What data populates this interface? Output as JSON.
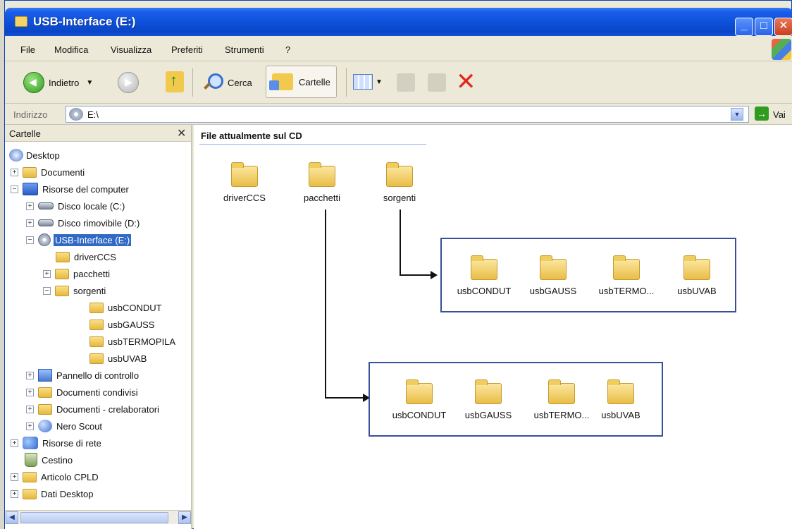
{
  "window": {
    "title": "USB-Interface (E:)"
  },
  "menu": [
    "File",
    "Modifica",
    "Visualizza",
    "Preferiti",
    "Strumenti",
    "?"
  ],
  "toolbar": {
    "back_label": "Indietro",
    "search_label": "Cerca",
    "folders_label": "Cartelle"
  },
  "address": {
    "label": "Indirizzo",
    "value": "E:\\",
    "go_label": "Vai"
  },
  "left_pane": {
    "title": "Cartelle",
    "tree": [
      {
        "label": "Desktop"
      },
      {
        "label": "Documenti"
      },
      {
        "label": "Risorse del computer"
      },
      {
        "label": "Disco locale (C:)"
      },
      {
        "label": "Disco rimovibile (D:)"
      },
      {
        "label": "USB-Interface (E:)"
      },
      {
        "label": "driverCCS"
      },
      {
        "label": "pacchetti"
      },
      {
        "label": "sorgenti"
      },
      {
        "label": "usbCONDUT"
      },
      {
        "label": "usbGAUSS"
      },
      {
        "label": "usbTERMOPILA"
      },
      {
        "label": "usbUVAB"
      },
      {
        "label": "Pannello di controllo"
      },
      {
        "label": "Documenti condivisi"
      },
      {
        "label": "Documenti - crelaboratori"
      },
      {
        "label": "Nero Scout"
      },
      {
        "label": "Risorse di rete"
      },
      {
        "label": "Cestino"
      },
      {
        "label": "Articolo CPLD"
      },
      {
        "label": "Dati Desktop"
      }
    ]
  },
  "right_pane": {
    "section_title": "File attualmente sul CD",
    "top_folders": [
      "driverCCS",
      "pacchetti",
      "sorgenti"
    ],
    "sorgenti_contents": [
      "usbCONDUT",
      "usbGAUSS",
      "usbTERMO...",
      "usbUVAB"
    ],
    "pacchetti_contents": [
      "usbCONDUT",
      "usbGAUSS",
      "usbTERMO...",
      "usbUVAB"
    ]
  }
}
